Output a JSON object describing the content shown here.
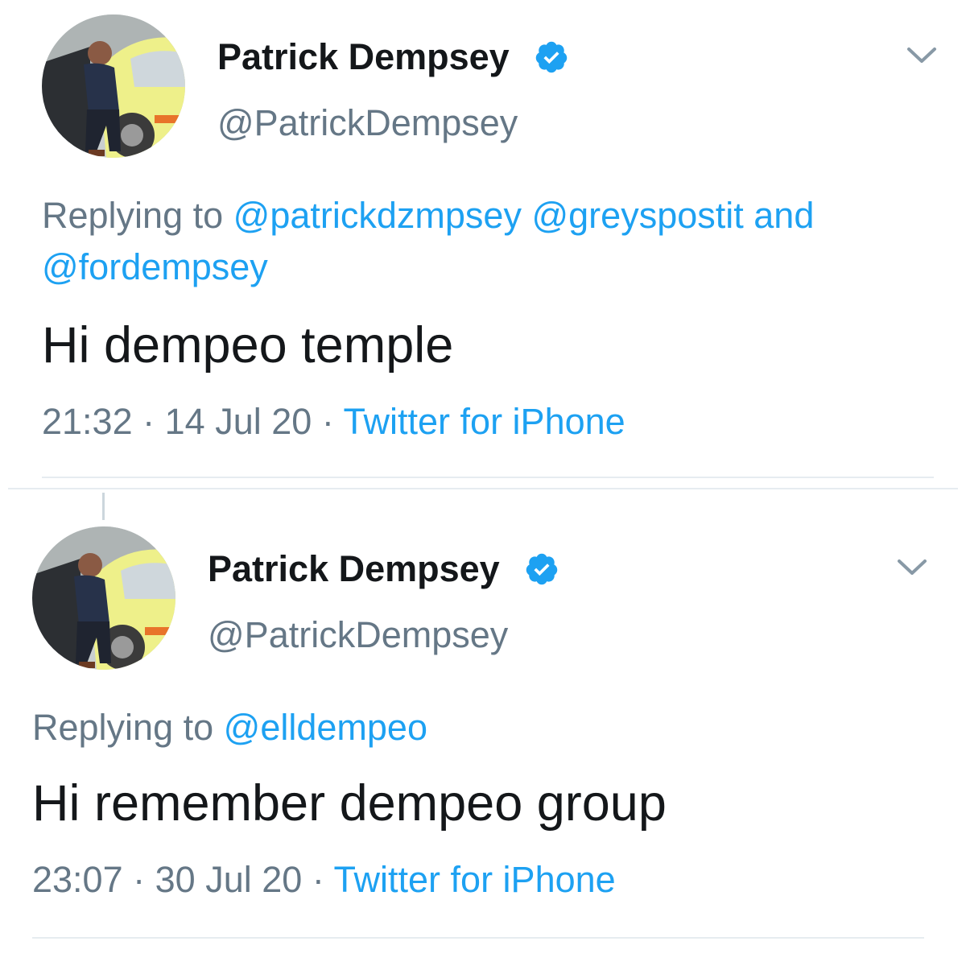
{
  "colors": {
    "link": "#1da1f2",
    "secondary_text": "#657786",
    "primary_text": "#14171a",
    "verified_badge": "#1da1f2",
    "divider": "#e6ecf0"
  },
  "tweets": [
    {
      "author_name": "Patrick Dempsey",
      "handle": "@PatrickDempsey",
      "verified_icon": "verified-badge-icon",
      "menu_icon": "chevron-down-icon",
      "replying_prefix": "Replying to",
      "mentions": [
        "@patrickdzmpsey",
        "@greyspostit"
      ],
      "mentions_joiner": "and",
      "last_mention": "@fordempsey",
      "text": "Hi dempeo temple",
      "time": "21:32",
      "date": "14 Jul 20",
      "source": "Twitter for iPhone",
      "separator": "·"
    },
    {
      "author_name": "Patrick Dempsey",
      "handle": "@PatrickDempsey",
      "verified_icon": "verified-badge-icon",
      "menu_icon": "chevron-down-icon",
      "replying_prefix": "Replying to",
      "mentions": [
        "@elldempeo"
      ],
      "text": "Hi remember dempeo group",
      "time": "23:07",
      "date": "30 Jul 20",
      "source": "Twitter for iPhone",
      "separator": "·"
    }
  ]
}
